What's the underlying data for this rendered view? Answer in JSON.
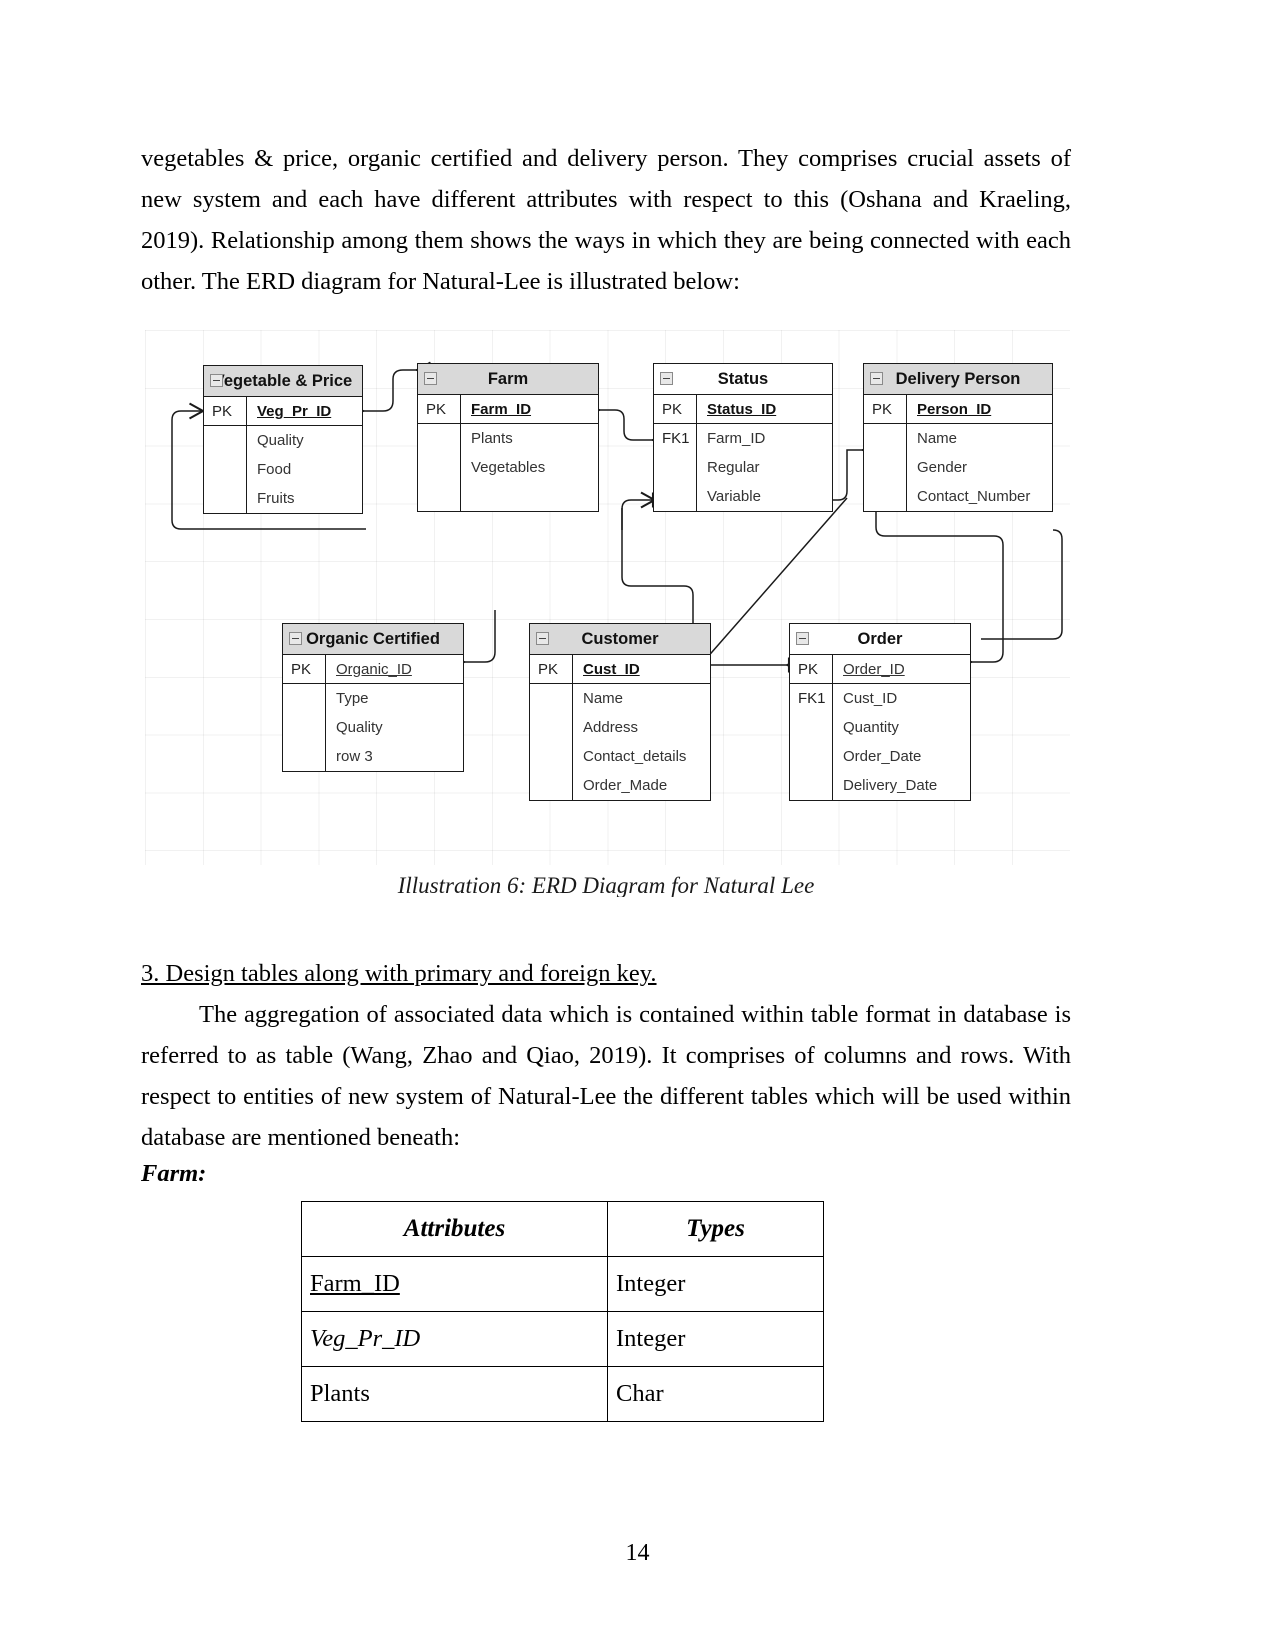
{
  "document": {
    "page_number": "14",
    "paragraph_top": "vegetables & price, organic certified and delivery person. They comprises crucial assets of new system and each have different attributes with respect to this (Oshana and Kraeling, 2019). Relationship among them shows the ways in which they are being connected with each other. The ERD diagram for Natural-Lee is illustrated below:",
    "figure_caption": "Illustration 6: ERD Diagram for Natural Lee",
    "section_heading": "3. Design tables along with primary and foreign key.",
    "paragraph_mid": "The aggregation of associated data which is contained within table format in database is referred to as table (Wang, Zhao and Qiao, 2019). It comprises of columns and rows. With respect to entities of new system of Natural-Lee the different tables which will be used within database are mentioned beneath:",
    "farm_label": "Farm:"
  },
  "attributes_table": {
    "headers": [
      "Attributes",
      "Types"
    ],
    "rows": [
      {
        "attribute": "Farm_ID",
        "type": "Integer",
        "style": "pk"
      },
      {
        "attribute": "Veg_Pr_ID",
        "type": "Integer",
        "style": "fk"
      },
      {
        "attribute": "Plants",
        "type": "Char",
        "style": "plain"
      }
    ]
  },
  "erd": {
    "entities": [
      {
        "id": "vegprice",
        "title": "Vegetable & Price",
        "header_fill": "#d9d9d9",
        "key_rows": [
          {
            "key": "PK",
            "name": "Veg_Pr_ID",
            "emphasis": "bold-underline"
          }
        ],
        "attributes": [
          {
            "key": "",
            "name": "Quality"
          },
          {
            "key": "",
            "name": "Food"
          },
          {
            "key": "",
            "name": "Fruits"
          }
        ]
      },
      {
        "id": "farm",
        "title": "Farm",
        "header_fill": "#d9d9d9",
        "key_rows": [
          {
            "key": "PK",
            "name": "Farm_ID",
            "emphasis": "bold-underline"
          }
        ],
        "attributes": [
          {
            "key": "",
            "name": "Plants"
          },
          {
            "key": "",
            "name": "Vegetables"
          }
        ]
      },
      {
        "id": "status",
        "title": "Status",
        "header_fill": "#ffffff",
        "key_rows": [
          {
            "key": "PK",
            "name": "Status_ID",
            "emphasis": "bold-underline"
          }
        ],
        "attributes": [
          {
            "key": "FK1",
            "name": "Farm_ID"
          },
          {
            "key": "",
            "name": "Regular"
          },
          {
            "key": "",
            "name": "Variable"
          }
        ]
      },
      {
        "id": "delivery",
        "title": "Delivery Person",
        "header_fill": "#d9d9d9",
        "key_rows": [
          {
            "key": "PK",
            "name": "Person_ID",
            "emphasis": "bold-underline"
          }
        ],
        "attributes": [
          {
            "key": "",
            "name": "Name"
          },
          {
            "key": "",
            "name": "Gender"
          },
          {
            "key": "",
            "name": "Contact_Number"
          }
        ]
      },
      {
        "id": "organic",
        "title": "Organic Certified",
        "header_fill": "#d9d9d9",
        "key_rows": [
          {
            "key": "PK",
            "name": "Organic_ID",
            "emphasis": "underline"
          }
        ],
        "attributes": [
          {
            "key": "",
            "name": "Type"
          },
          {
            "key": "",
            "name": "Quality"
          },
          {
            "key": "",
            "name": "row 3"
          }
        ]
      },
      {
        "id": "customer",
        "title": "Customer",
        "header_fill": "#d9d9d9",
        "key_rows": [
          {
            "key": "PK",
            "name": "Cust_ID",
            "emphasis": "bold-underline"
          }
        ],
        "attributes": [
          {
            "key": "",
            "name": "Name"
          },
          {
            "key": "",
            "name": "Address"
          },
          {
            "key": "",
            "name": "Contact_details"
          },
          {
            "key": "",
            "name": "Order_Made"
          }
        ]
      },
      {
        "id": "order",
        "title": "Order",
        "header_fill": "#ffffff",
        "key_rows": [
          {
            "key": "PK",
            "name": "Order_ID",
            "emphasis": "underline"
          }
        ],
        "attributes": [
          {
            "key": "FK1",
            "name": "Cust_ID"
          },
          {
            "key": "",
            "name": "Quantity"
          },
          {
            "key": "",
            "name": "Order_Date"
          },
          {
            "key": "",
            "name": "Delivery_Date"
          }
        ]
      }
    ]
  }
}
